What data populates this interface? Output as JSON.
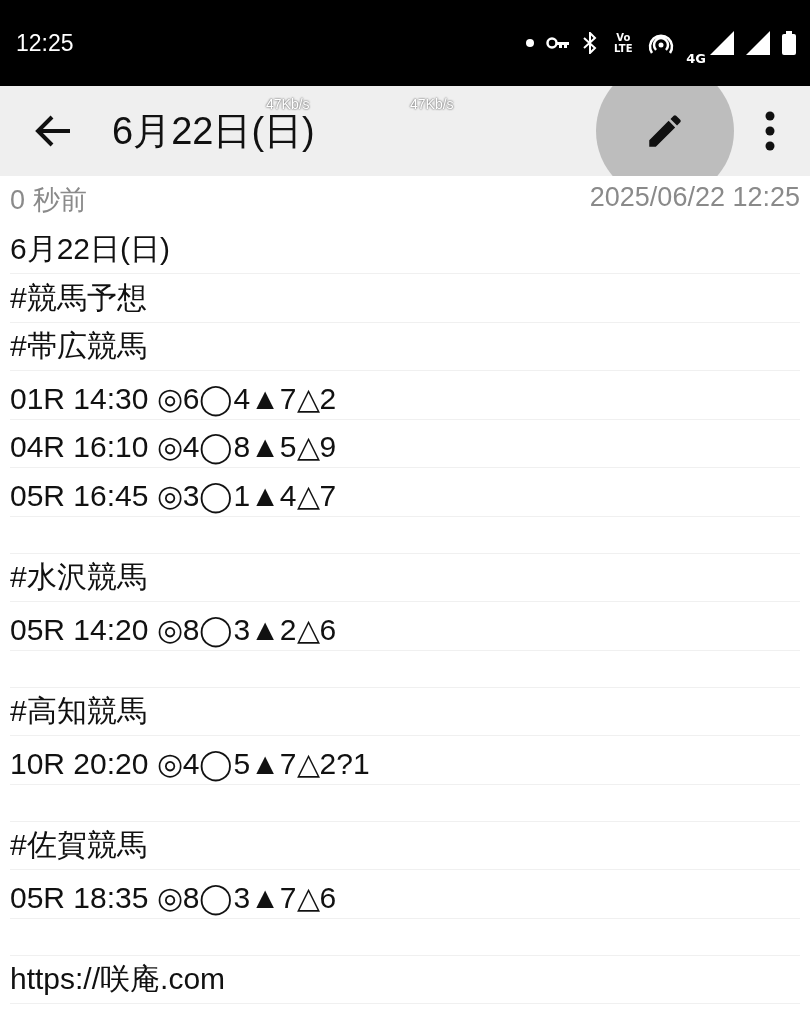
{
  "status_bar": {
    "time": "12:25",
    "vo_lte": "Vo LTE",
    "network": "4G"
  },
  "speed_overlay": [
    "47Kb/s",
    "47Kb/s"
  ],
  "toolbar": {
    "title": "6月22日(日)"
  },
  "meta": {
    "relative_time": "0 秒前",
    "timestamp": "2025/06/22 12:25"
  },
  "lines": [
    {
      "kind": "text",
      "text": "6月22日(日)"
    },
    {
      "kind": "text",
      "text": "#競馬予想"
    },
    {
      "kind": "text",
      "text": "#帯広競馬"
    },
    {
      "kind": "text",
      "text": "01R 14:30 ◎6◯4▲7△2"
    },
    {
      "kind": "text",
      "text": "04R 16:10 ◎4◯8▲5△9"
    },
    {
      "kind": "text",
      "text": "05R 16:45 ◎3◯1▲4△7"
    },
    {
      "kind": "blank"
    },
    {
      "kind": "text",
      "text": "#水沢競馬"
    },
    {
      "kind": "text",
      "text": "05R 14:20 ◎8◯3▲2△6"
    },
    {
      "kind": "blank"
    },
    {
      "kind": "text",
      "text": "#高知競馬"
    },
    {
      "kind": "text",
      "text": "10R 20:20 ◎4◯5▲7△2?1"
    },
    {
      "kind": "blank"
    },
    {
      "kind": "text",
      "text": "#佐賀競馬"
    },
    {
      "kind": "text",
      "text": "05R 18:35 ◎8◯3▲7△6"
    },
    {
      "kind": "blank"
    },
    {
      "kind": "text",
      "text": "https://咲庵.com"
    }
  ]
}
